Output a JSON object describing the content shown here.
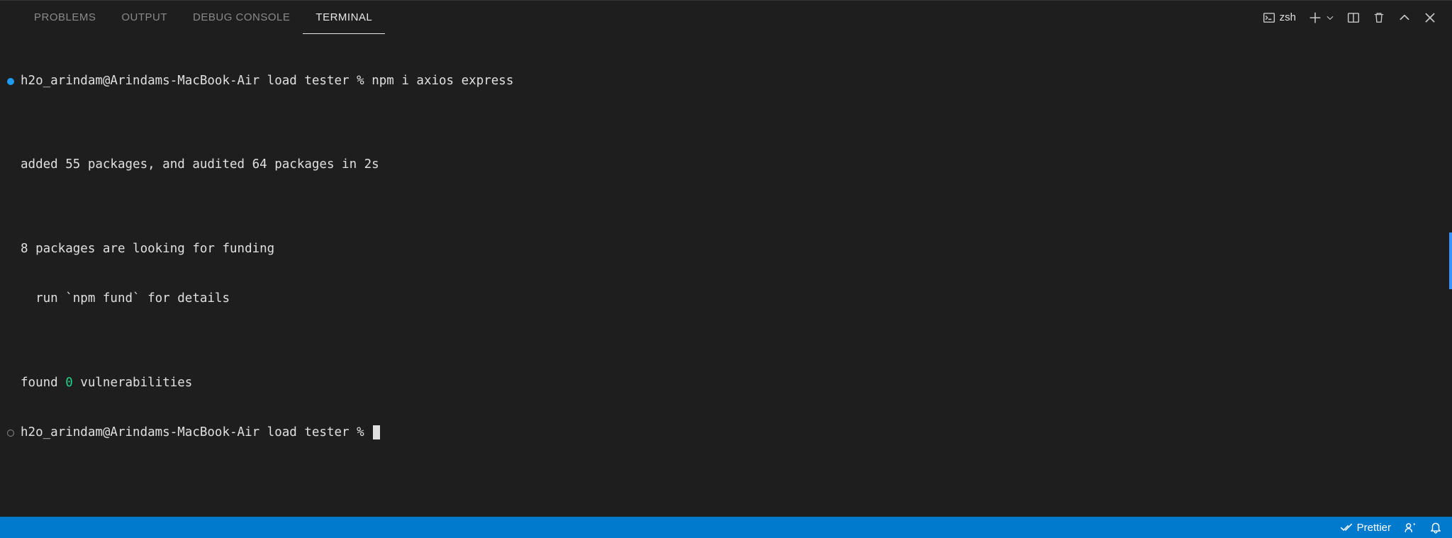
{
  "tabs": {
    "problems": "PROBLEMS",
    "output": "OUTPUT",
    "debug_console": "DEBUG CONSOLE",
    "terminal": "TERMINAL"
  },
  "toolbar": {
    "shell": "zsh"
  },
  "terminal": {
    "prompt1_prefix": "h2o_arindam@Arindams-MacBook-Air load tester % ",
    "prompt1_cmd": "npm i axios express",
    "blank1": "",
    "out1": "added 55 packages, and audited 64 packages in 2s",
    "blank2": "",
    "out2": "8 packages are looking for funding",
    "out3": "  run `npm fund` for details",
    "blank3": "",
    "found_prefix": "found ",
    "found_zero": "0",
    "found_suffix": " vulnerabilities",
    "prompt2": "h2o_arindam@Arindams-MacBook-Air load tester % "
  },
  "status": {
    "prettier": "Prettier"
  }
}
